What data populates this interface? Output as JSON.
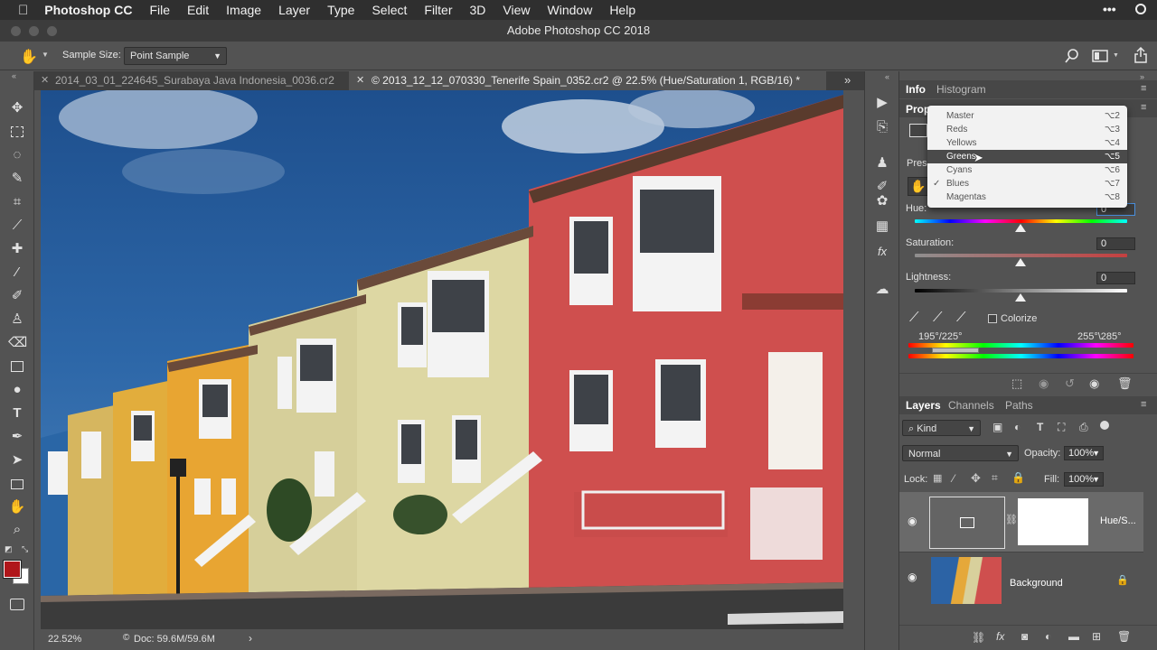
{
  "menubar": {
    "apple_icon": "apple-icon",
    "app_name": "Photoshop CC",
    "items": [
      "File",
      "Edit",
      "Image",
      "Layer",
      "Type",
      "Select",
      "Filter",
      "3D",
      "View",
      "Window",
      "Help"
    ],
    "right_icons": [
      "more-icon",
      "siri-icon",
      "list-icon"
    ]
  },
  "window": {
    "title": "Adobe Photoshop CC 2018"
  },
  "options_bar": {
    "sample_size_label": "Sample Size:",
    "sample_size_value": "Point Sample"
  },
  "tabs": [
    {
      "label": "2014_03_01_224645_Surabaya Java Indonesia_0036.cr2",
      "active": false
    },
    {
      "label": "© 2013_12_12_070330_Tenerife Spain_0352.cr2 @ 22.5% (Hue/Saturation 1, RGB/16) *",
      "active": true
    }
  ],
  "status": {
    "zoom": "22.52%",
    "doc": "Doc: 59.6M/59.6M"
  },
  "panels": {
    "top_tabs": [
      "Info",
      "Histogram"
    ],
    "properties_title": "Prop",
    "preset_label": "Pres",
    "hue": {
      "label": "Hue:",
      "value": "0"
    },
    "saturation": {
      "label": "Saturation:",
      "value": "0"
    },
    "lightness": {
      "label": "Lightness:",
      "value": "0"
    },
    "colorize_label": "Colorize",
    "range_left": "195°/225°",
    "range_right": "255°\\285°",
    "layer_tabs": [
      "Layers",
      "Channels",
      "Paths"
    ],
    "kind_label": "Kind",
    "blend_mode": "Normal",
    "opacity_label": "Opacity:",
    "opacity_value": "100%",
    "lock_label": "Lock:",
    "fill_label": "Fill:",
    "fill_value": "100%",
    "layers": [
      {
        "name": "Hue/S...",
        "type": "adjustment"
      },
      {
        "name": "Background",
        "type": "image"
      }
    ]
  },
  "dropdown": {
    "items": [
      {
        "name": "Master",
        "shortcut": "⌥2",
        "checked": false,
        "highlighted": false
      },
      {
        "name": "Reds",
        "shortcut": "⌥3",
        "checked": false,
        "highlighted": false
      },
      {
        "name": "Yellows",
        "shortcut": "⌥4",
        "checked": false,
        "highlighted": false
      },
      {
        "name": "Greens",
        "shortcut": "⌥5",
        "checked": false,
        "highlighted": true
      },
      {
        "name": "Cyans",
        "shortcut": "⌥6",
        "checked": false,
        "highlighted": false
      },
      {
        "name": "Blues",
        "shortcut": "⌥7",
        "checked": true,
        "highlighted": false
      },
      {
        "name": "Magentas",
        "shortcut": "⌥8",
        "checked": false,
        "highlighted": false
      }
    ]
  },
  "colors": {
    "foreground": "#b0161a",
    "background": "#ffffff",
    "accent": "#2f7bd8"
  }
}
